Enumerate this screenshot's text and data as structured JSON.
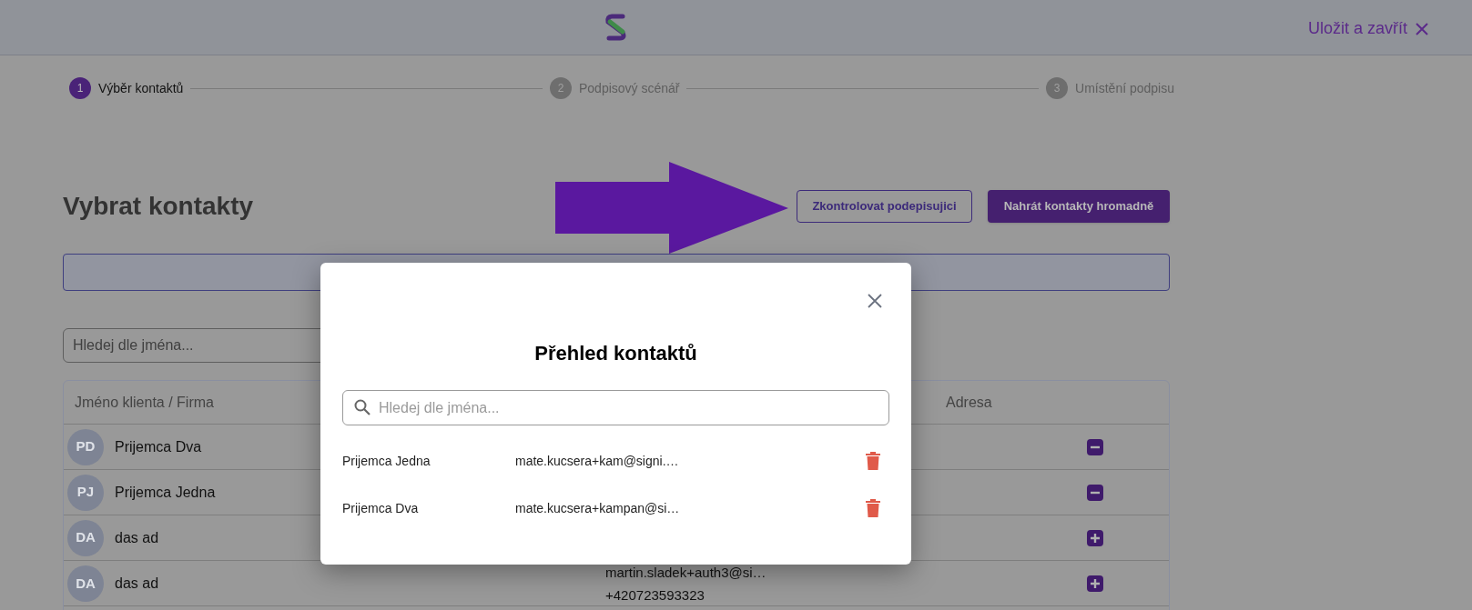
{
  "header": {
    "save_close": "Uložit a zavřít"
  },
  "stepper": [
    {
      "number": "1",
      "label": "Výběr kontaktů",
      "selected": true
    },
    {
      "number": "2",
      "label": "Podpisový scénář",
      "selected": false
    },
    {
      "number": "3",
      "label": "Umístění podpisu",
      "selected": false
    }
  ],
  "page_title": "Vybrat kontakty",
  "buttons": [
    {
      "label": "Zkontrolovat podepisujici",
      "kind": "outline"
    },
    {
      "label": "Nahrát kontakty hromadně",
      "kind": "filled"
    }
  ],
  "search": {
    "placeholder": "Hledej dle jména..."
  },
  "table": {
    "columns": [
      "Jméno klienta / Firma",
      "Adresa"
    ],
    "rows": [
      {
        "initials": "PD",
        "name": "Prijemca Dva",
        "selected": true
      },
      {
        "initials": "PJ",
        "name": "Prijemca Jedna",
        "selected": true
      },
      {
        "initials": "DA",
        "name": "das ad",
        "selected": false
      },
      {
        "initials": "DA",
        "name": "das ad",
        "selected": false,
        "contact_lines": [
          "martin.sladek+auth3@si…",
          "+420723593323"
        ]
      }
    ]
  },
  "modal": {
    "title": "Přehled kontaktů",
    "search_placeholder": "Hledej dle jména...",
    "contacts": [
      {
        "name": "Prijemca Jedna",
        "email": "mate.kucsera+kam@signi.…"
      },
      {
        "name": "Prijemca Dva",
        "email": "mate.kucsera+kampan@si…"
      }
    ]
  }
}
